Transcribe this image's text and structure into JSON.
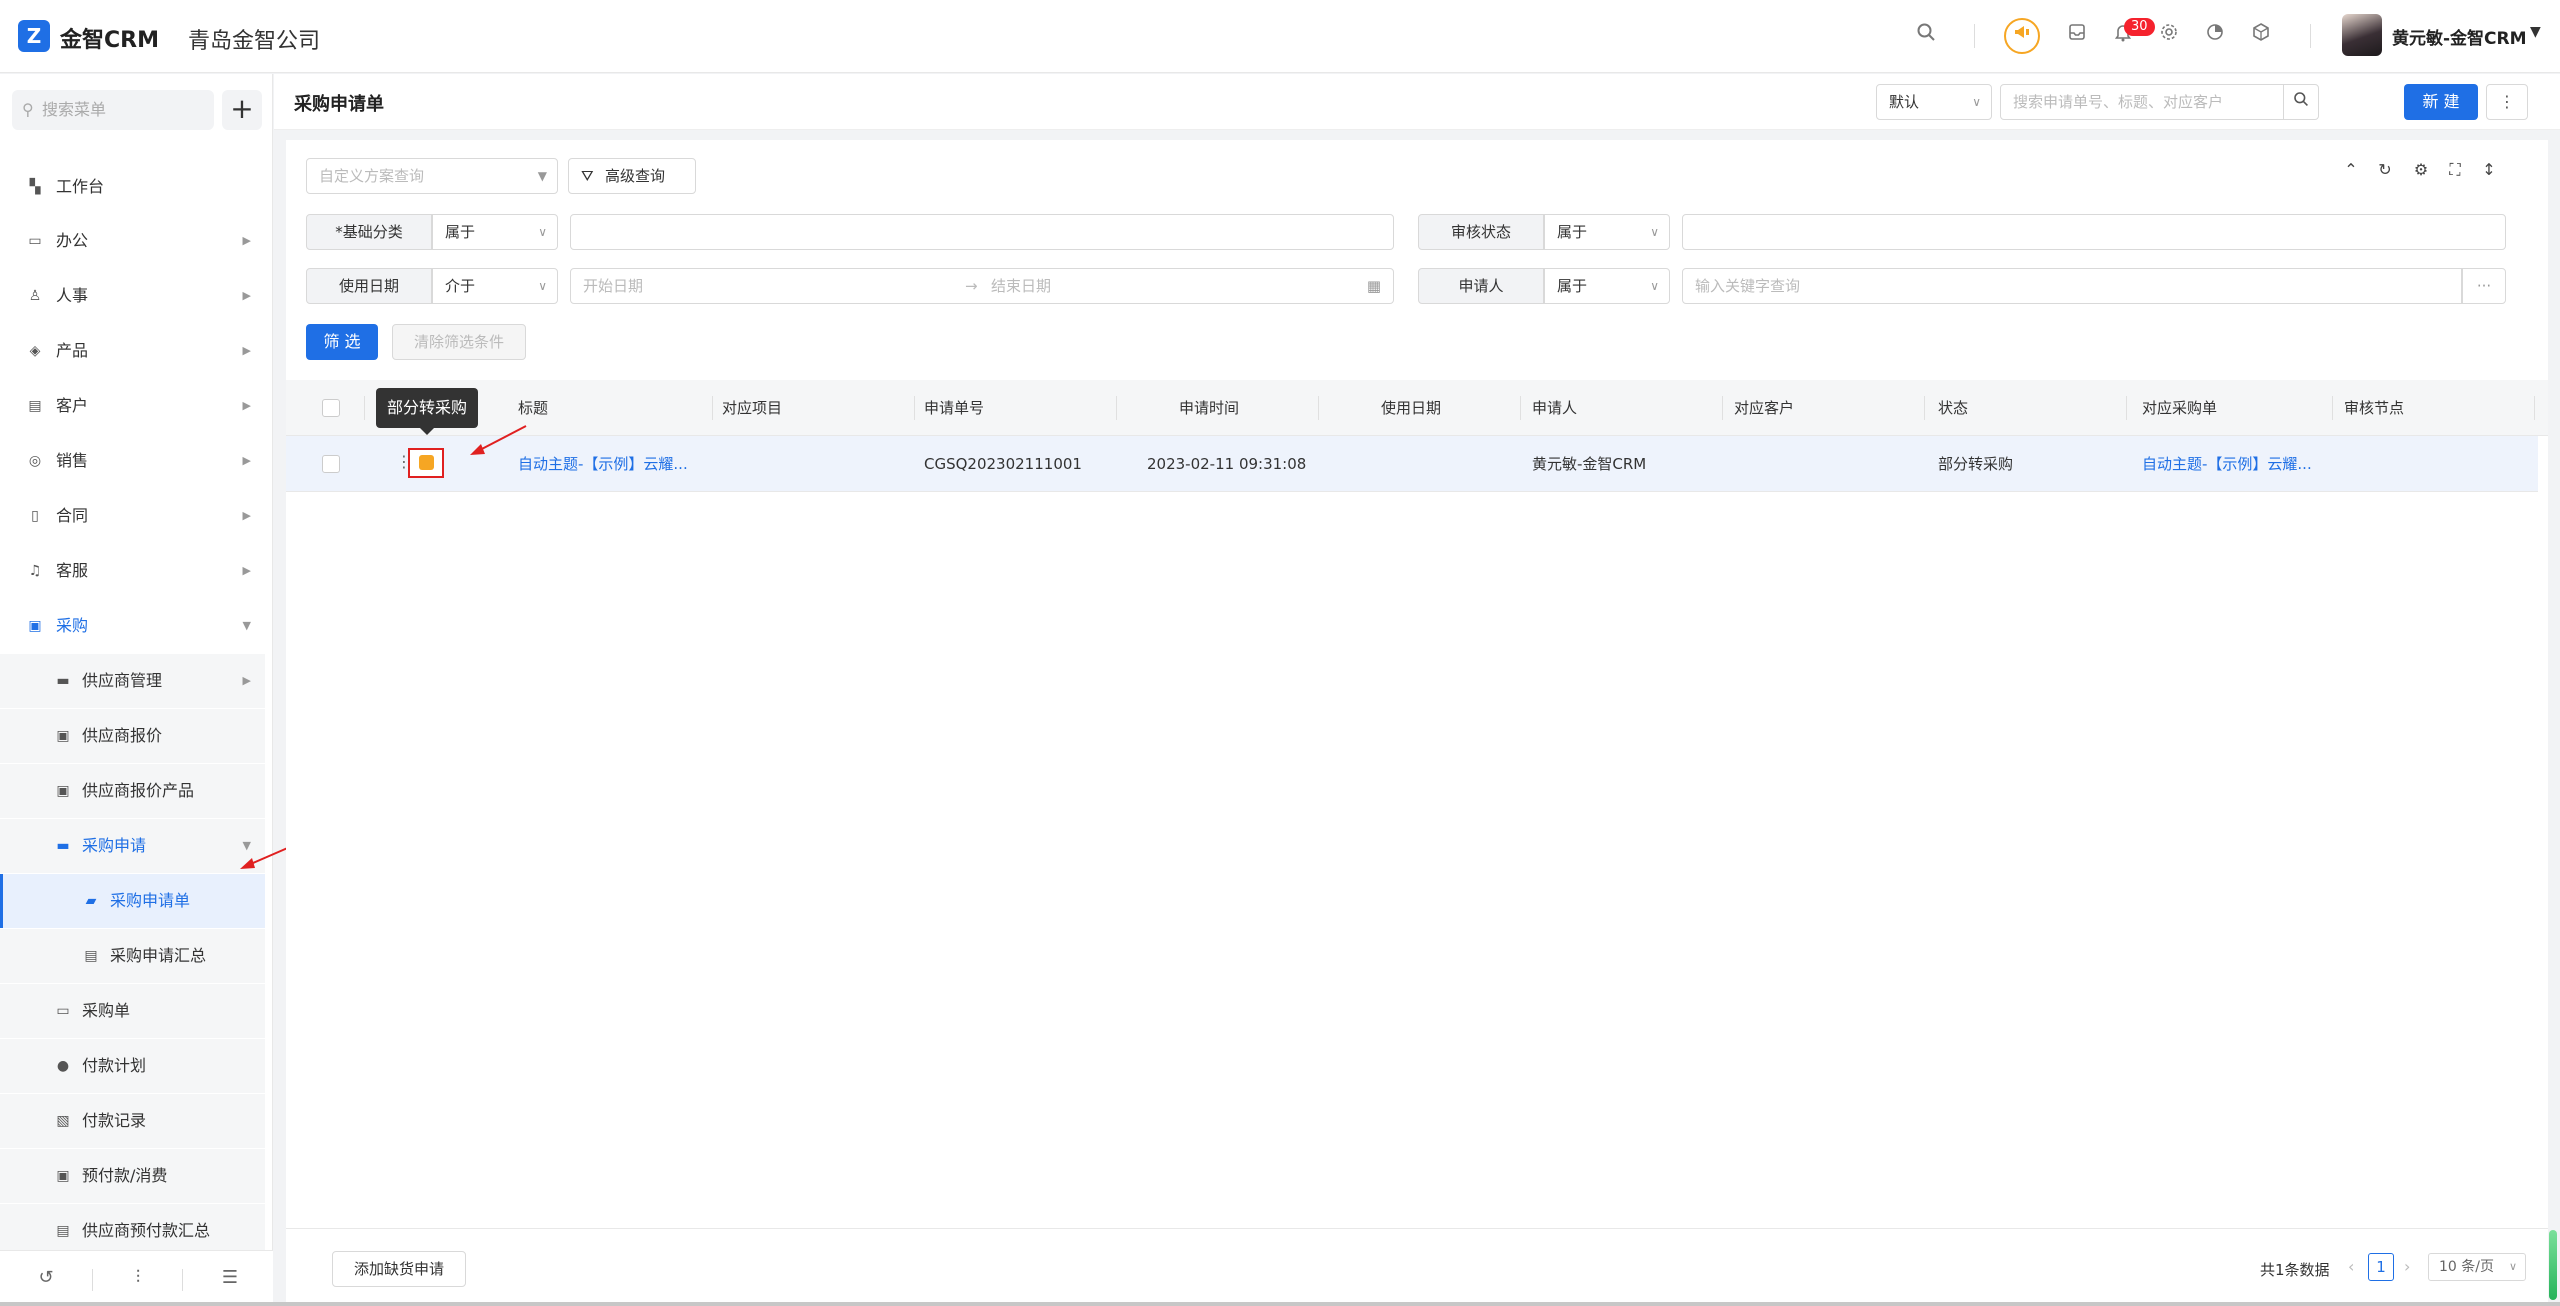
{
  "app": {
    "logo_mark": "Z",
    "logo_text": "金智CRM",
    "company": "青岛金智公司",
    "badge_count": "30",
    "user_name": "黄元敏-金智CRM"
  },
  "sidebar": {
    "search_placeholder": "搜索菜单",
    "items": [
      {
        "label": "工作台",
        "icon": "dashboard-icon"
      },
      {
        "label": "办公",
        "icon": "office-icon"
      },
      {
        "label": "人事",
        "icon": "people-icon"
      },
      {
        "label": "产品",
        "icon": "box-icon"
      },
      {
        "label": "客户",
        "icon": "customer-icon"
      },
      {
        "label": "销售",
        "icon": "sales-icon"
      },
      {
        "label": "合同",
        "icon": "contract-icon"
      },
      {
        "label": "客服",
        "icon": "headset-icon"
      },
      {
        "label": "采购",
        "icon": "purchase-icon"
      },
      {
        "label": "供应商管理",
        "icon": "folder-icon"
      },
      {
        "label": "供应商报价",
        "icon": "quote-icon"
      },
      {
        "label": "供应商报价产品",
        "icon": "quote-product-icon"
      },
      {
        "label": "采购申请",
        "icon": "folder-open-icon"
      },
      {
        "label": "采购申请单",
        "icon": "request-form-icon"
      },
      {
        "label": "采购申请汇总",
        "icon": "summary-icon"
      },
      {
        "label": "采购单",
        "icon": "order-icon"
      },
      {
        "label": "付款计划",
        "icon": "plan-icon"
      },
      {
        "label": "付款记录",
        "icon": "record-icon"
      },
      {
        "label": "预付款/消费",
        "icon": "prepay-icon"
      },
      {
        "label": "供应商预付款汇总",
        "icon": "prepay-summary-icon"
      }
    ]
  },
  "header": {
    "title": "采购申请单",
    "view_select": "默认",
    "search_placeholder": "搜索申请单号、标题、对应客户",
    "new_label": "新 建"
  },
  "filters": {
    "scheme_placeholder": "自定义方案查询",
    "advanced_label": "高级查询",
    "row1": [
      {
        "label": "*基础分类",
        "op": "属于"
      },
      {
        "label": "审核状态",
        "op": "属于"
      }
    ],
    "row2": [
      {
        "label": "使用日期",
        "op": "介于",
        "start_placeholder": "开始日期",
        "end_placeholder": "结束日期"
      },
      {
        "label": "申请人",
        "op": "属于",
        "placeholder": "输入关键字查询"
      }
    ],
    "filter_btn": "筛 选",
    "clear_btn": "清除筛选条件"
  },
  "table": {
    "columns": [
      "标题",
      "对应项目",
      "申请单号",
      "申请时间",
      "使用日期",
      "申请人",
      "对应客户",
      "状态",
      "对应采购单",
      "审核节点"
    ],
    "rows": [
      {
        "title": "自动主题-【示例】云耀...",
        "project": "",
        "number": "CGSQ202302111001",
        "time": "2023-02-11 09:31:08",
        "use_date": "",
        "applicant": "黄元敏-金智CRM",
        "customer": "",
        "status": "部分转采购",
        "po": "自动主题-【示例】云耀...",
        "node": ""
      }
    ],
    "tooltip": "部分转采购"
  },
  "footer": {
    "add_btn": "添加缺货申请",
    "total": "共1条数据",
    "page": "1",
    "page_size": "10 条/页"
  },
  "colors": {
    "primary": "#1f6fe5",
    "highlight": "#e02020",
    "warning": "#f6a623"
  }
}
